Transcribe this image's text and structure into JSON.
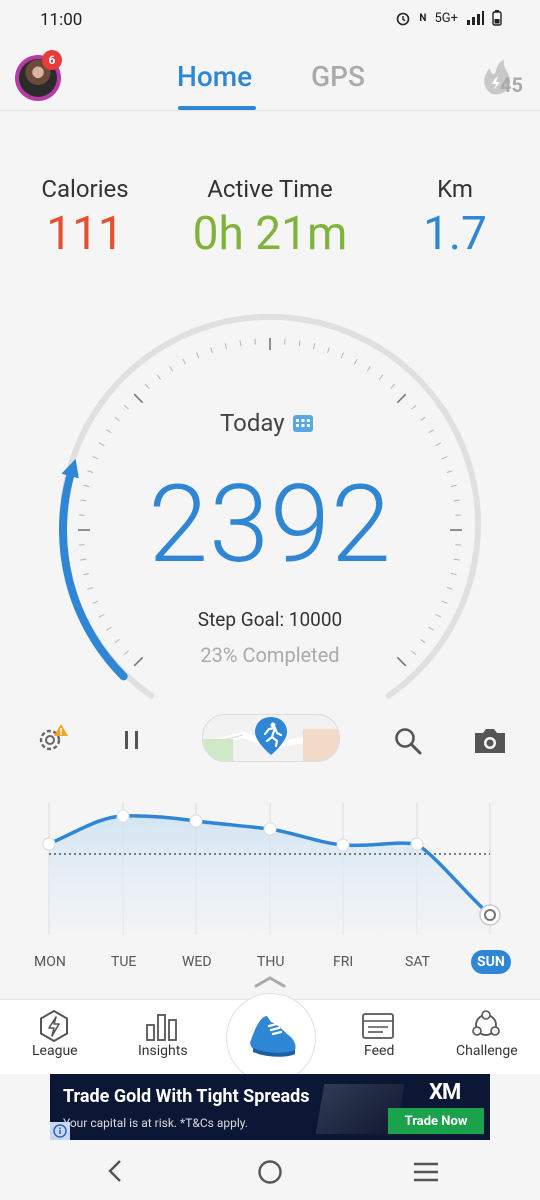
{
  "status_bar": {
    "time": "11:00",
    "network": "5G+",
    "icons": [
      "alarm-icon",
      "nfc-icon",
      "signal-icon",
      "battery-icon"
    ]
  },
  "header": {
    "notification_count": "6",
    "tabs": [
      {
        "label": "Home",
        "active": true
      },
      {
        "label": "GPS",
        "active": false
      }
    ],
    "streak_count": "45"
  },
  "stats": [
    {
      "label": "Calories",
      "value": "111",
      "color": "#e5502e"
    },
    {
      "label": "Active Time",
      "value": "0h 21m",
      "color": "#7fb33a"
    },
    {
      "label": "Km",
      "value": "1.7",
      "color": "#2f86d4"
    }
  ],
  "gauge": {
    "period_label": "Today",
    "steps": "2392",
    "goal_text": "Step Goal: 10000",
    "completed_text": "23% Completed",
    "progress": 0.23
  },
  "controls": {
    "settings_icon": "gear-warning-icon",
    "pause_icon": "pause-icon",
    "map_icon": "runner-pin-icon",
    "search_icon": "search-icon",
    "camera_icon": "camera-icon"
  },
  "week": {
    "days": [
      "MON",
      "TUE",
      "WED",
      "THU",
      "FRI",
      "SAT",
      "SUN"
    ],
    "selected": "SUN"
  },
  "bottom_nav": [
    {
      "label": "League",
      "icon": "lightning-hexagon-icon"
    },
    {
      "label": "Insights",
      "icon": "bar-chart-icon"
    },
    {
      "label": "",
      "icon": "shoe-icon"
    },
    {
      "label": "Feed",
      "icon": "feed-icon"
    },
    {
      "label": "Challenge",
      "icon": "challenge-icon"
    }
  ],
  "ad": {
    "title": "Trade Gold With Tight Spreads",
    "subtitle": "Your capital is at risk. *T&Cs apply.",
    "button": "Trade Now",
    "brand": "XM"
  },
  "system_nav": [
    "back-icon",
    "home-icon",
    "recents-icon"
  ]
}
